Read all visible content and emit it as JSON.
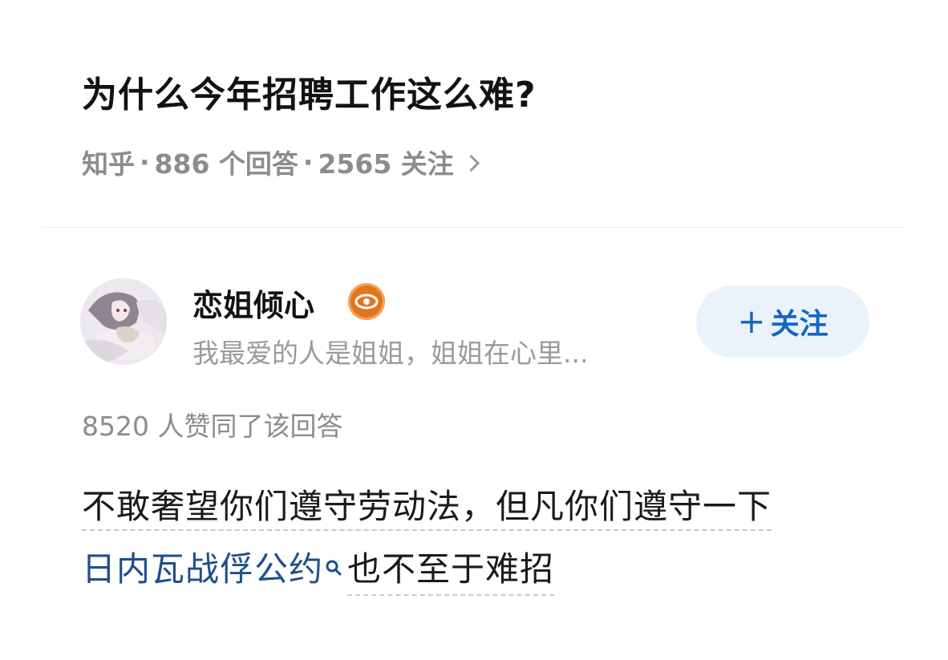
{
  "question": {
    "title": "为什么今年招聘工作这么难?",
    "source": "知乎",
    "separator": "·",
    "answers_count": "886 个回答",
    "followers_count": "2565 关注"
  },
  "author": {
    "name": "恋姐倾心",
    "bio": "我最爱的人是姐姐，姐姐在心里...",
    "follow_label": "关注",
    "follow_plus": "+"
  },
  "answer": {
    "vote_text": "8520 人赞同了该回答",
    "line1": "不敢奢望你们遵守劳动法，但凡你们遵守一下",
    "link_term": "日内瓦战俘公约",
    "line2_rest": "也不至于难招"
  },
  "colors": {
    "link": "#1f4e8c",
    "follow_text": "#1766c0",
    "follow_bg": "#eaf2fb",
    "meta_gray": "#8c8c8c",
    "badge": "#e2761f"
  },
  "icons": {
    "badge": "eye-badge-icon",
    "chevron": "chevron-right-icon",
    "search": "search-icon"
  }
}
